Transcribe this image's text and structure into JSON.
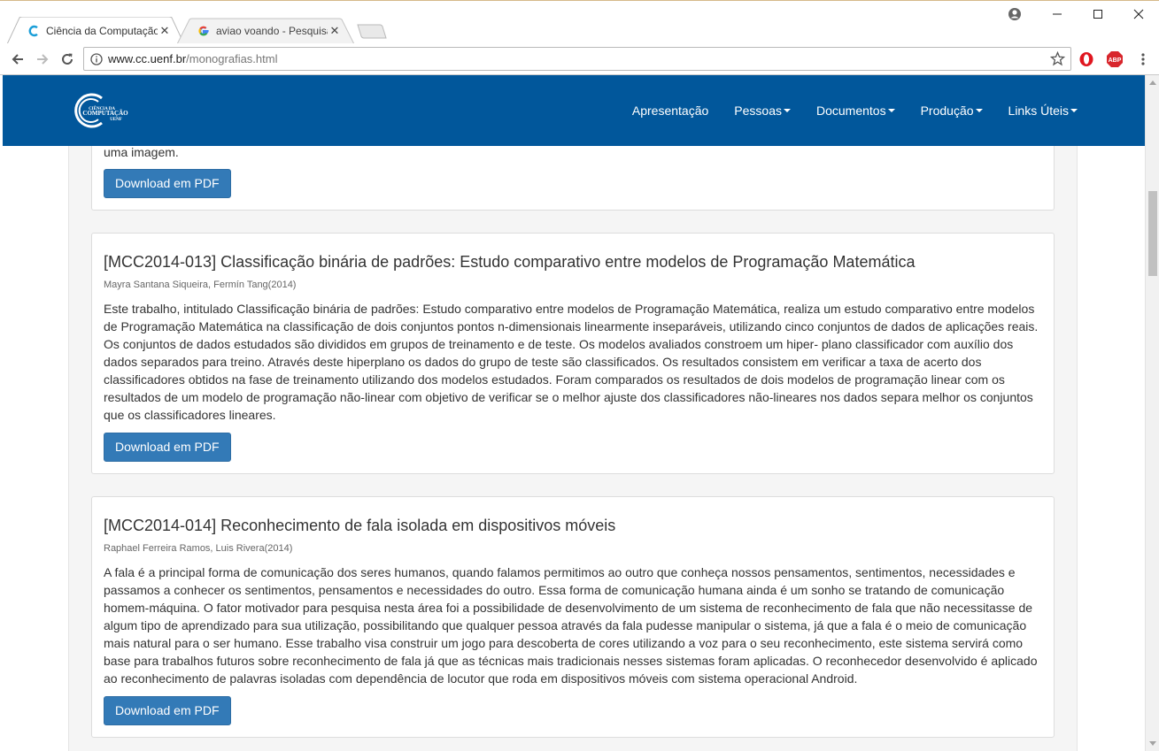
{
  "browser": {
    "tabs": [
      {
        "title": "Ciência da Computação - ",
        "close": "✕",
        "favicon": "c-logo-icon"
      },
      {
        "title": "aviao voando - Pesquisa",
        "close": "✕",
        "favicon": "google-icon"
      }
    ],
    "url_host": "www.cc.uenf.br",
    "url_path": "/monografias.html",
    "extensions": [
      "opera-icon",
      "adblock-plus-icon"
    ],
    "abp_label": "ABP"
  },
  "site": {
    "logo_alt": "Ciência da Computação UENF",
    "logo_lines": [
      "CIÊNCIA DA",
      "COMPUTAÇÃO",
      "UENF"
    ],
    "nav": [
      {
        "label": "Apresentação",
        "dropdown": false
      },
      {
        "label": "Pessoas",
        "dropdown": true
      },
      {
        "label": "Documentos",
        "dropdown": true
      },
      {
        "label": "Produção",
        "dropdown": true
      },
      {
        "label": "Links Úteis",
        "dropdown": true
      }
    ]
  },
  "fragment": {
    "text": "uma imagem.",
    "button": "Download em PDF"
  },
  "monographs": [
    {
      "title": "[MCC2014-013] Classificação binária de padrões: Estudo comparativo entre modelos de Programação Matemática",
      "authors": "Mayra Santana Siqueira, Fermín Tang(2014)",
      "abstract": "Este trabalho, intitulado Classificação binária de padrões: Estudo comparativo entre modelos de Programação Matemática, realiza um estudo comparativo entre modelos de Programação Matemática na classificação de dois conjuntos pontos n-dimensionais linearmente inseparáveis, utilizando cinco conjuntos de dados de aplicações reais. Os conjuntos de dados estudados são divididos em grupos de treinamento e de teste. Os modelos avaliados constroem um hiper- plano classificador com auxílio dos dados separados para treino. Através deste hiperplano os dados do grupo de teste são classificados. Os resultados consistem em verificar a taxa de acerto dos classificadores obtidos na fase de treinamento utilizando dos modelos estudados. Foram comparados os resultados de dois modelos de programação linear com os resultados de um modelo de programação não-linear com objetivo de verificar se o melhor ajuste dos classificadores não-lineares nos dados separa melhor os conjuntos que os classificadores lineares.",
      "button": "Download em PDF"
    },
    {
      "title": "[MCC2014-014] Reconhecimento de fala isolada em dispositivos móveis",
      "authors": "Raphael Ferreira Ramos, Luis Rivera(2014)",
      "abstract": "A fala é a principal forma de comunicação dos seres humanos, quando falamos permitimos ao outro que conheça nossos pensamentos, sentimentos, necessidades e passamos a conhecer os sentimentos, pensamentos e necessidades do outro. Essa forma de comunicação humana ainda é um sonho se tratando de comunicação homem-máquina. O fator motivador para pesquisa nesta área foi a possibilidade de desenvolvimento de um sistema de reconhecimento de fala que não necessitasse de algum tipo de aprendizado para sua utilização, possibilitando que qualquer pessoa através da fala pudesse manipular o sistema, já que a fala é o meio de comunicação mais natural para o ser humano. Esse trabalho visa construir um jogo para descoberta de cores utilizando a voz para o seu reconhecimento, este sistema servirá como base para trabalhos futuros sobre reconhecimento de fala já que as técnicas mais tradicionais nesses sistemas foram aplicadas. O reconhecedor desenvolvido é aplicado ao reconhecimento de palavras isoladas com dependência de locutor que roda em dispositivos móveis com sistema operacional Android.",
      "button": "Download em PDF"
    }
  ],
  "colors": {
    "navbar": "#01579b",
    "button": "#337ab7",
    "abp_red": "#d8262c",
    "opera_red": "#e0161f"
  }
}
